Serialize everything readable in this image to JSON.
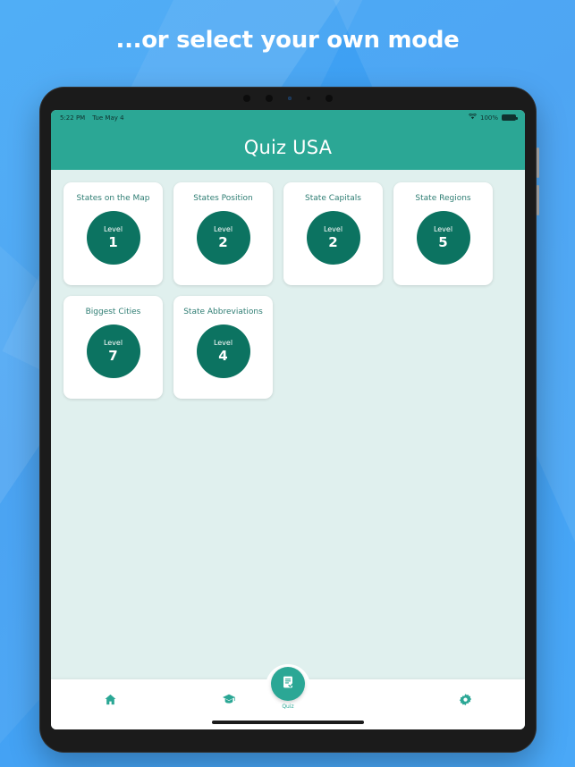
{
  "promo": {
    "headline": "...or select your own mode",
    "background_color": "#3f9ef2"
  },
  "device": {
    "type": "tablet",
    "status_bar": {
      "time": "5:22 PM",
      "date": "Tue May 4",
      "wifi_icon": "wifi-icon",
      "battery_percent": "100%",
      "battery_icon": "battery-full-icon"
    }
  },
  "app": {
    "title": "Quiz USA",
    "accent_color": "#2ba795",
    "badge_color": "#0c7361",
    "content_background": "#e0f0ee",
    "card_title_color": "#2e7d73",
    "level_word": "Level",
    "cards": [
      {
        "title": "States on the Map",
        "level_word": "Level",
        "level": "1"
      },
      {
        "title": "States Position",
        "level_word": "Level",
        "level": "2"
      },
      {
        "title": "State Capitals",
        "level_word": "Level",
        "level": "2"
      },
      {
        "title": "State Regions",
        "level_word": "Level",
        "level": "5"
      },
      {
        "title": "Biggest Cities",
        "level_word": "Level",
        "level": "7"
      },
      {
        "title": "State Abbreviations",
        "level_word": "Level",
        "level": "4"
      }
    ],
    "bottom_nav": {
      "items": [
        {
          "icon": "home-icon",
          "label": ""
        },
        {
          "icon": "graduation-cap-icon",
          "label": ""
        },
        {
          "icon": "settings-gear-icon",
          "label": ""
        }
      ],
      "fab": {
        "icon": "quiz-document-icon",
        "label": "Quiz"
      }
    }
  }
}
